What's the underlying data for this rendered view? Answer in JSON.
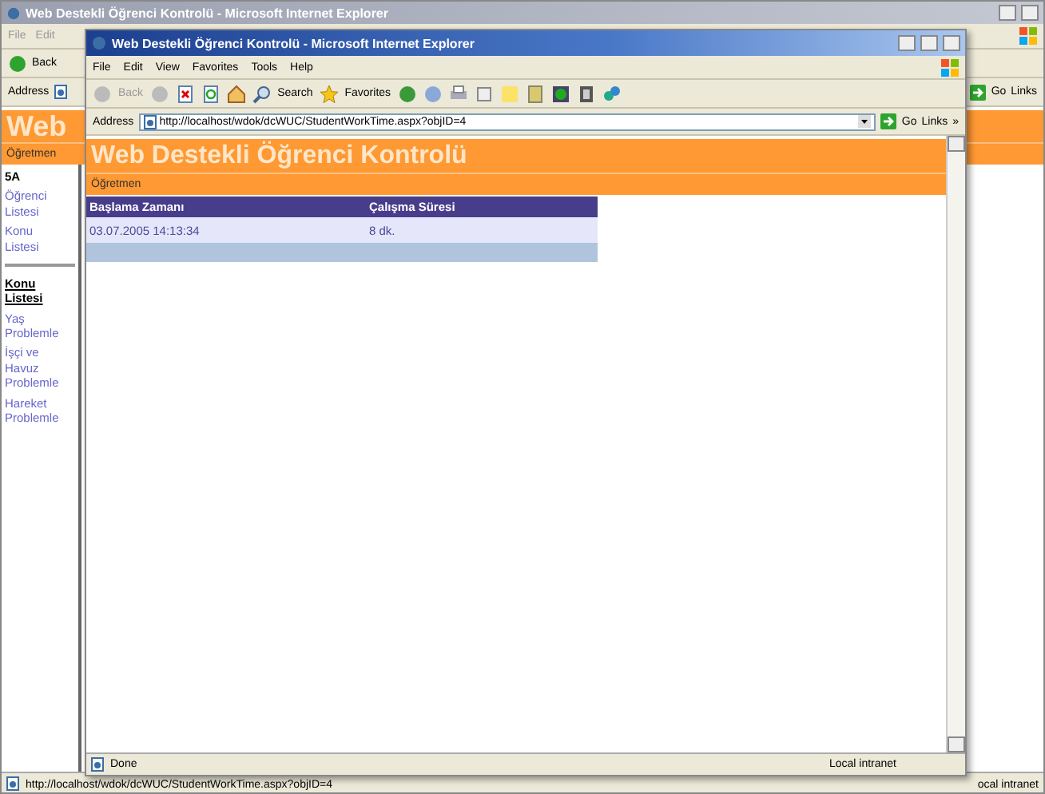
{
  "background_window": {
    "title": "Web Destekli Öğrenci Kontrolü - Microsoft Internet Explorer",
    "menu": [
      "File",
      "Edit"
    ],
    "back": "Back",
    "address_label": "Address",
    "go": "Go",
    "links": "Links",
    "page": {
      "banner": "Web",
      "role": "Öğretmen",
      "class_name": "5A",
      "nav": [
        "Öğrenci Listesi",
        "Konu Listesi"
      ],
      "section": "Konu Listesi",
      "topics": [
        "Yaş Problemle",
        "İşçi ve Havuz Problemle",
        "Hareket Problemle"
      ]
    },
    "status": {
      "text": "http://localhost/wdok/dcWUC/StudentWorkTime.aspx?objID=4",
      "zone": "ocal intranet"
    }
  },
  "window": {
    "title": "Web Destekli Öğrenci Kontrolü - Microsoft Internet Explorer",
    "menu": [
      "File",
      "Edit",
      "View",
      "Favorites",
      "Tools",
      "Help"
    ],
    "back": "Back",
    "search": "Search",
    "favorites": "Favorites",
    "address_label": "Address",
    "address": "http://localhost/wdok/dcWUC/StudentWorkTime.aspx?objID=4",
    "go": "Go",
    "links": "Links",
    "links_chevron": "»",
    "page": {
      "banner": "Web Destekli Öğrenci Kontrolü",
      "role": "Öğretmen",
      "table": {
        "columns": [
          "Başlama Zamanı",
          "Çalışma Süresi"
        ],
        "rows": [
          [
            "03.07.2005 14:13:34",
            "8 dk."
          ]
        ]
      }
    },
    "status": {
      "text": "Done",
      "zone": "Local intranet"
    }
  }
}
